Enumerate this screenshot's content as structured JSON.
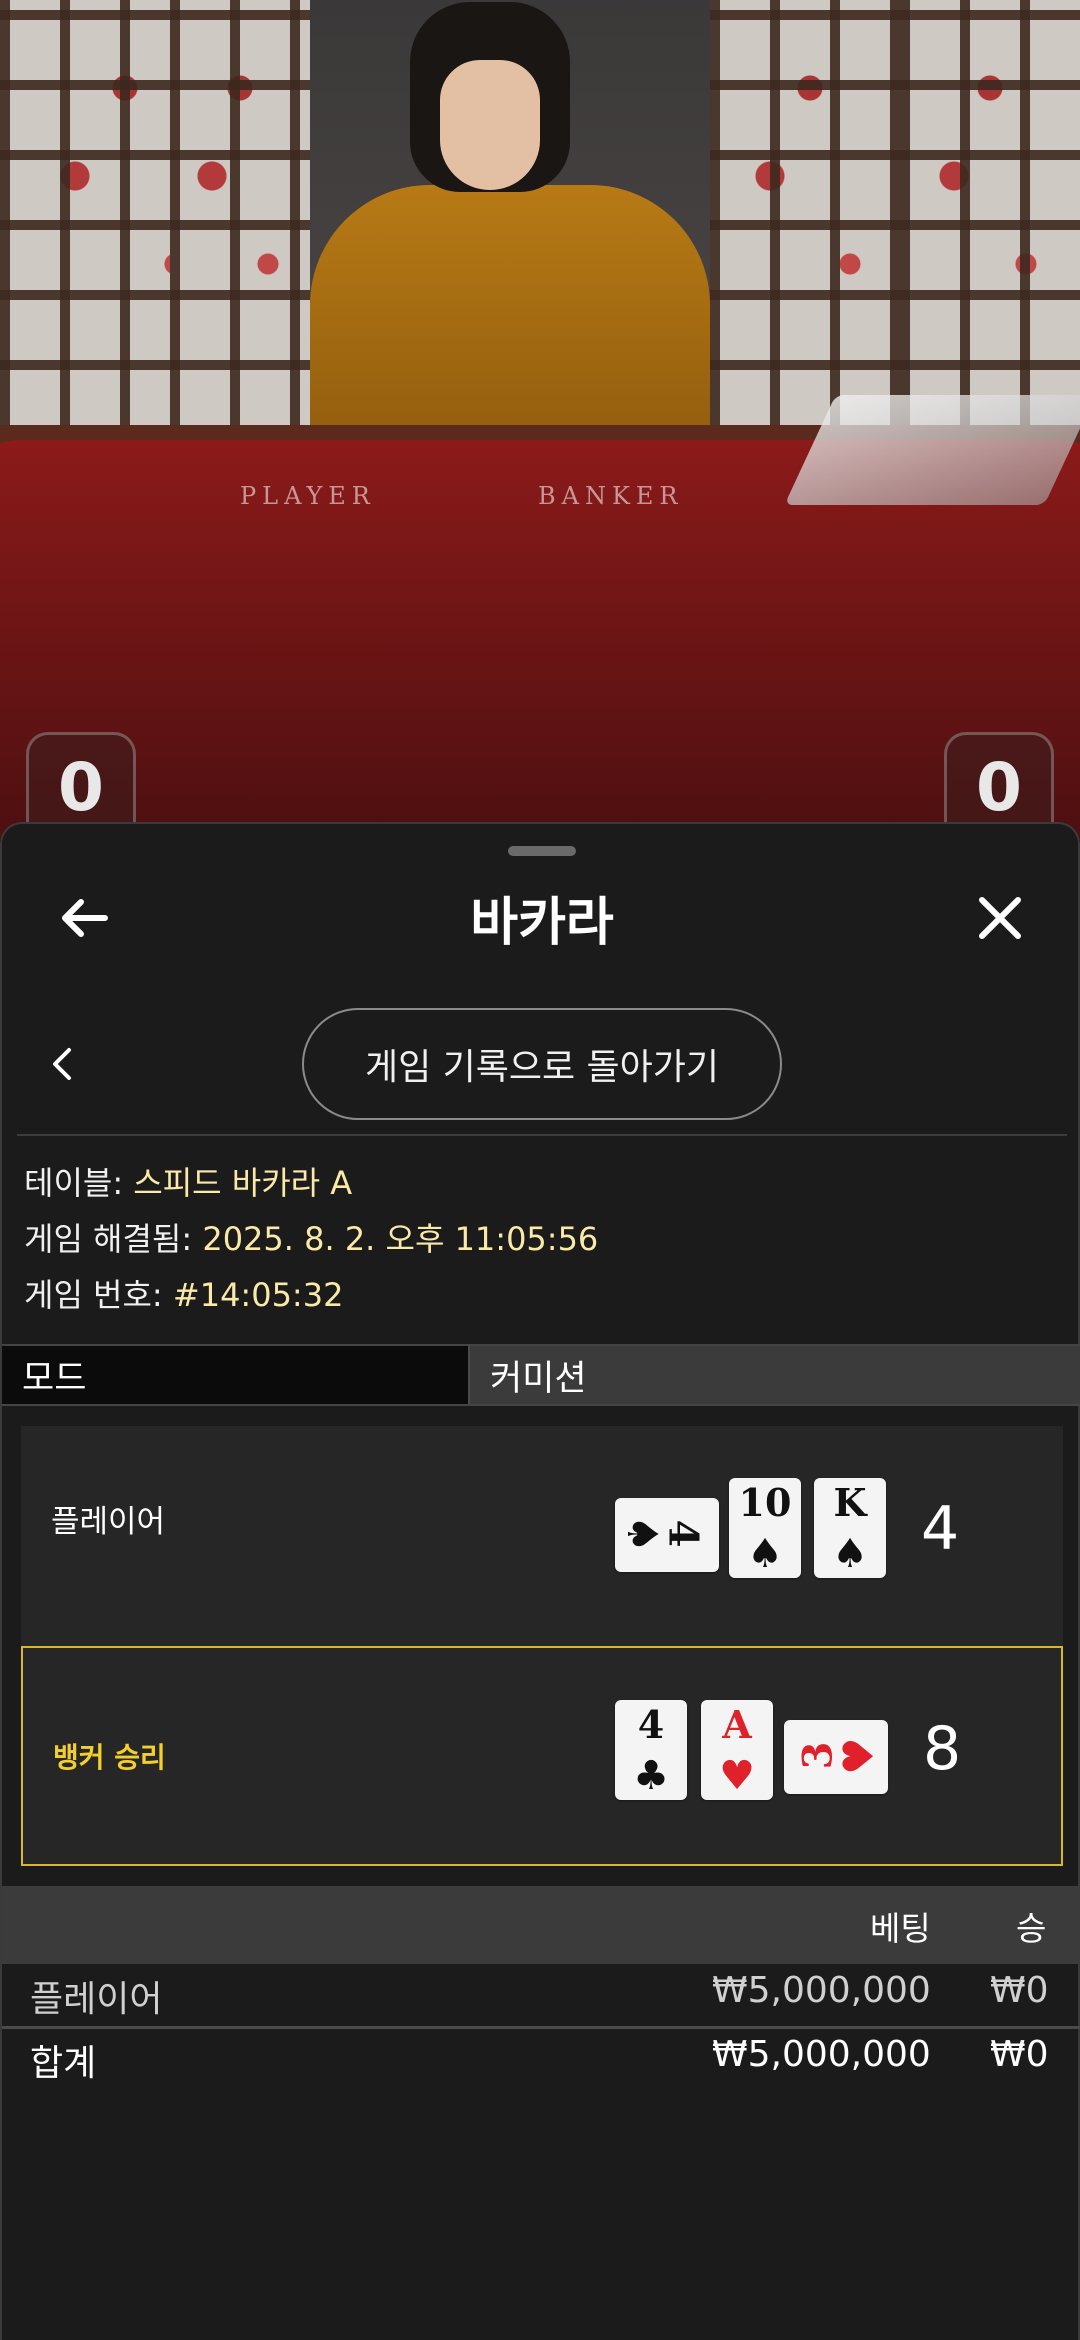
{
  "video": {
    "table_labels": {
      "player": "PLAYER",
      "banker": "BANKER"
    },
    "scores": {
      "player": "0",
      "banker": "0"
    }
  },
  "header": {
    "title": "바카라",
    "back_icon": "arrow-left-icon",
    "close_icon": "close-icon"
  },
  "subnav": {
    "prev_icon": "chevron-left-icon",
    "back_to_history_label": "게임 기록으로 돌아가기"
  },
  "info": {
    "table_label": "테이블: ",
    "table_value": "스피드 바카라 A",
    "resolved_label": "게임 해결됨: ",
    "resolved_value": "2025. 8. 2. 오후 11:05:56",
    "number_label": "게임 번호: ",
    "number_value": "#14:05:32"
  },
  "tabs": {
    "mode": "모드",
    "commission": "커미션"
  },
  "hands": {
    "player": {
      "label": "플레이어",
      "total": "4",
      "cards": [
        {
          "rank": "4",
          "suit": "♠",
          "color": "#111111",
          "orientation": "sideways"
        },
        {
          "rank": "10",
          "suit": "♠",
          "color": "#111111",
          "orientation": "upright"
        },
        {
          "rank": "K",
          "suit": "♠",
          "color": "#111111",
          "orientation": "upright"
        }
      ]
    },
    "banker": {
      "label": "뱅커 승리",
      "total": "8",
      "highlight_color": "#d6b829",
      "cards": [
        {
          "rank": "4",
          "suit": "♣",
          "color": "#111111",
          "orientation": "upright"
        },
        {
          "rank": "A",
          "suit": "♥",
          "color": "#e0212b",
          "orientation": "upright"
        },
        {
          "rank": "3",
          "suit": "♥",
          "color": "#e0212b",
          "orientation": "sideways"
        }
      ]
    }
  },
  "bets": {
    "col_bet": "베팅",
    "col_win": "승",
    "rows": [
      {
        "label": "플레이어",
        "bet": "₩5,000,000",
        "win": "₩0"
      },
      {
        "label": "합계",
        "bet": "₩5,000,000",
        "win": "₩0"
      }
    ]
  }
}
